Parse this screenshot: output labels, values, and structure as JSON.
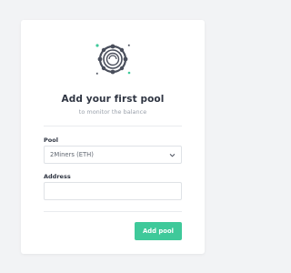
{
  "card": {
    "title": "Add your first pool",
    "subtitle": "to monitor the balance"
  },
  "form": {
    "pool_label": "Pool",
    "pool_value": "2Miners (ETH)",
    "address_label": "Address",
    "address_value": "",
    "submit_label": "Add pool"
  },
  "icons": {
    "hero": "mining-pool-icon",
    "select": "chevron-down-icon"
  },
  "colors": {
    "background": "#f2f3f5",
    "card": "#ffffff",
    "accent": "#3fc99a",
    "title": "#2f3542",
    "muted": "#9aa1ab",
    "border": "#dfe2e6"
  }
}
